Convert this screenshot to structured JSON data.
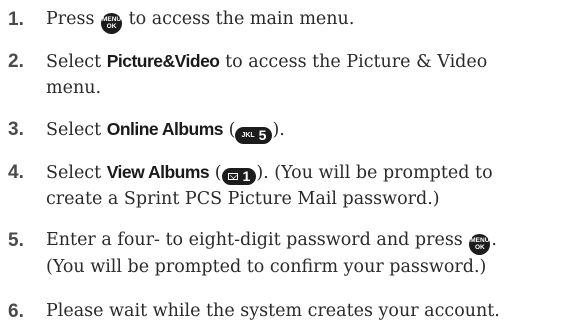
{
  "steps": [
    {
      "number": "1.",
      "before": "Press ",
      "key": {
        "icon": "menu-ok-key-icon",
        "top": "MENU",
        "bottom": "OK"
      },
      "after": " to access the main menu."
    },
    {
      "number": "2.",
      "before": "Select ",
      "bold": "Picture&Video",
      "after": " to access the Picture & Video",
      "line2": "menu."
    },
    {
      "number": "3.",
      "before": "Select ",
      "bold": "Online Albums",
      "paren_open": " (",
      "key": {
        "icon": "jkl-5-key-icon",
        "small": "JKL",
        "big": "5"
      },
      "paren_close": ")."
    },
    {
      "number": "4.",
      "before": "Select ",
      "bold": "View Albums",
      "paren_open": " (",
      "key": {
        "icon": "envelope-1-key-icon",
        "big": "1"
      },
      "after": "). (You will be prompted to",
      "line2": "create a Sprint PCS Picture Mail password.)"
    },
    {
      "number": "5.",
      "before": "Enter a four- to eight-digit password and press ",
      "key": {
        "icon": "menu-ok-key-icon",
        "top": "MENU",
        "bottom": "OK"
      },
      "after": ".",
      "line2": "(You will be prompted to confirm your password.)"
    },
    {
      "number": "6.",
      "text": "Please wait while the system creates your account."
    }
  ]
}
